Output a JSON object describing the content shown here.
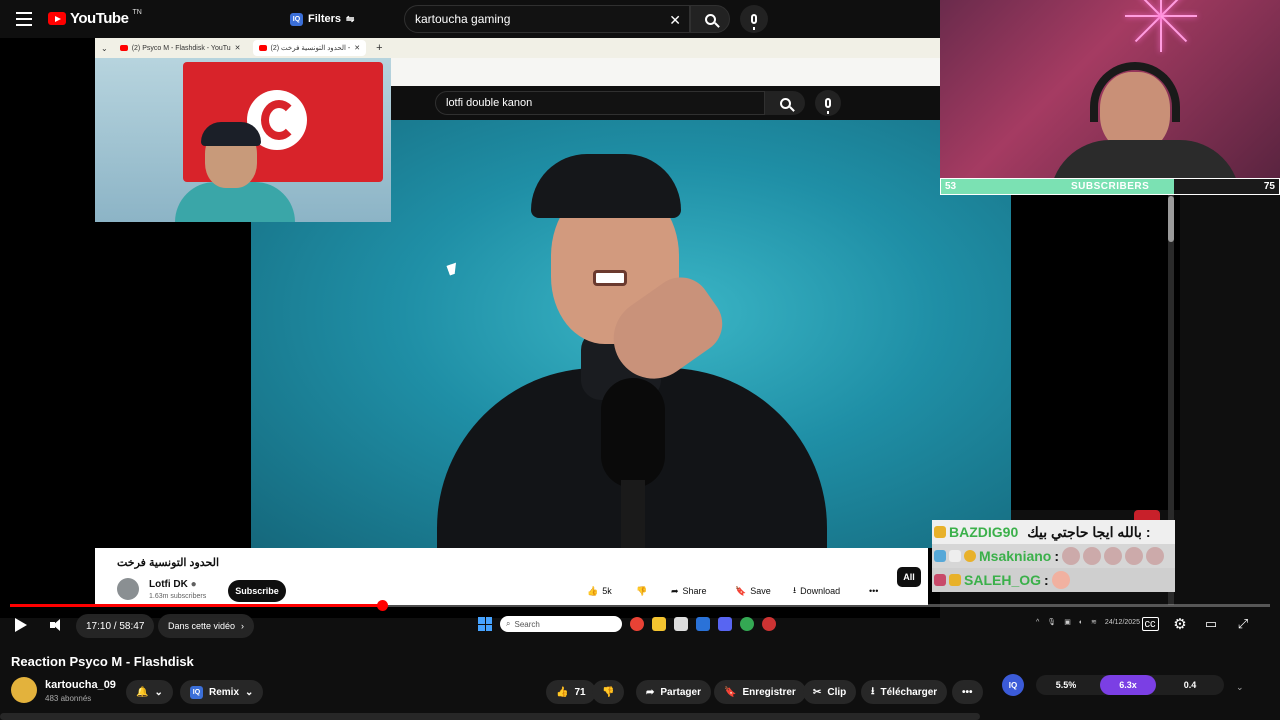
{
  "topbar": {
    "logo_text": "YouTube",
    "logo_tm": "TN",
    "filters_label": "Filters",
    "filters_badge": "IQ",
    "search_value": "kartoucha gaming"
  },
  "browser": {
    "tabs": [
      {
        "label": "(2) Psyco M - Flashdisk - YouTu"
      },
      {
        "label": "(2) الحدود التونسية فرخت - "
      }
    ],
    "inner_search_value": "lotfi double kanon"
  },
  "stream_overlay": {
    "subs_start": "53",
    "subs_label": "SUBSCRIBERS",
    "subs_end": "75",
    "subs_progress": 0.69,
    "chat": [
      {
        "nick": "BAZDIG90",
        "message": "بالله ايجا حاجتي بيك :"
      },
      {
        "nick": "Msakniano",
        "message": ":"
      },
      {
        "nick": "SALEH_OG",
        "message": ":"
      }
    ]
  },
  "inner_video": {
    "title": "الحدود التونسية فرخت",
    "channel": "Lotfi DK",
    "subscribers": "1.63m subscribers",
    "subscribe_label": "Subscribe",
    "likes": "5k",
    "share_label": "Share",
    "save_label": "Save",
    "download_label": "Download",
    "all_chip": "All"
  },
  "player": {
    "progress": 0.295,
    "time": "17:10 / 58:47",
    "chapter_label": "Dans cette vidéo",
    "taskbar_search": "Search",
    "tray_date": "24/12/2025"
  },
  "video_info": {
    "title": "Reaction Psyco M - Flashdisk",
    "channel": "kartoucha_09",
    "subscribers": "483 abonnés",
    "remix_label": "Remix",
    "likes": "71",
    "share_label": "Partager",
    "save_label": "Enregistrer",
    "clip_label": "Clip",
    "download_label": "Télécharger"
  },
  "extension": {
    "badge": "IQ",
    "stat1": "5.5%",
    "stat2": "6.3x",
    "stat3": "0.4"
  },
  "colors": {
    "youtube_red": "#ff0000",
    "subs_bar": "#7be1b3",
    "nick_green": "#3bb04a",
    "stat_purple": "#7b3fe4"
  }
}
